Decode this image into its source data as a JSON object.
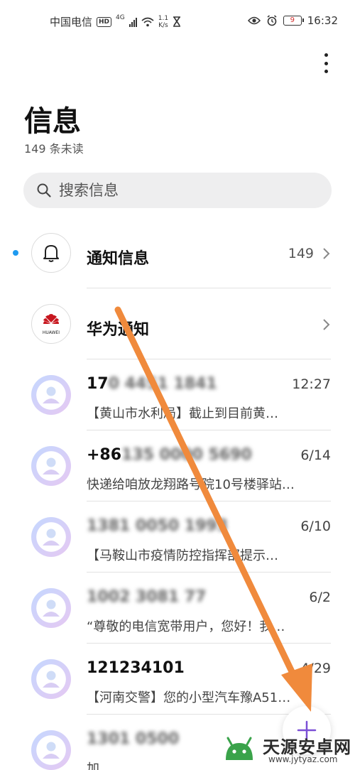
{
  "status_bar": {
    "carrier": "中国电信",
    "hd": "HD",
    "network": "4G",
    "speed_value": "1.1",
    "speed_unit": "K/s",
    "battery": "9",
    "time": "16:32"
  },
  "header": {
    "title": "信息",
    "unread_count": "149 条未读"
  },
  "search": {
    "placeholder": "搜索信息"
  },
  "conversations": [
    {
      "name": "通知信息",
      "count": "149",
      "unread": true,
      "icon": "bell-icon"
    },
    {
      "name": "华为通知",
      "icon": "huawei-logo",
      "logo_text": "HUAWEI"
    },
    {
      "name": "17",
      "name_hidden": "0 4451 1841",
      "time": "12:27",
      "preview": "【黄山市水利局】截止到目前黄…"
    },
    {
      "name": "+86",
      "name_hidden": "135 0000 5690",
      "time": "6/14",
      "preview": "快递给咱放龙翔路号院10号楼驿站…"
    },
    {
      "name": "",
      "name_hidden": "1381 0050 1993",
      "time": "6/10",
      "preview": "【马鞍山市疫情防控指挥部提示…"
    },
    {
      "name": "",
      "name_hidden": "1002 3081 77",
      "time": "6/2",
      "preview": "“尊敬的电信宽带用户，您好！我…"
    },
    {
      "name": "121234101",
      "time": "4/29",
      "preview": "【河南交警】您的小型汽车豫A51…"
    },
    {
      "name": "",
      "name_hidden": "1301 0500",
      "time": "",
      "preview": "加"
    }
  ],
  "watermark": {
    "text": "天源安卓网",
    "url": "www.jytyaz.com"
  },
  "colors": {
    "accent": "#1e9af0",
    "fab_plus": "#7b4fd6",
    "annotation_arrow": "#f08a3c"
  }
}
